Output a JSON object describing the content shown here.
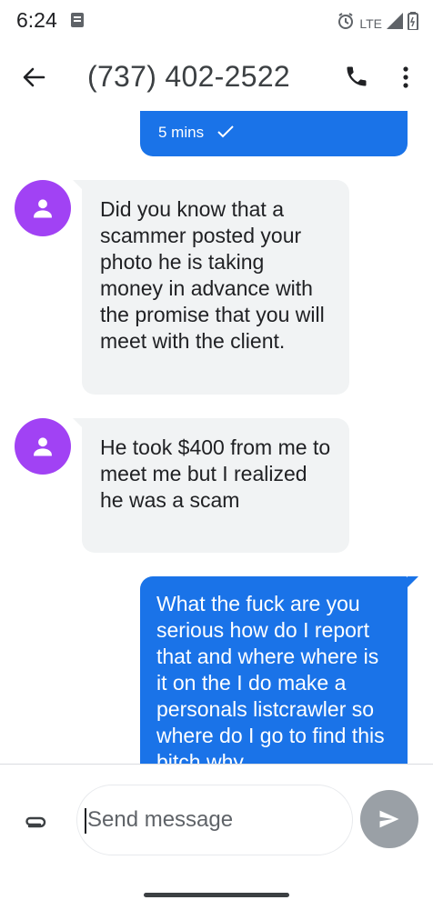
{
  "status_bar": {
    "time": "6:24",
    "network": "LTE"
  },
  "header": {
    "contact": "(737) 402-2522"
  },
  "conversation": {
    "sent_status": "5 mins",
    "messages": [
      {
        "direction": "incoming",
        "text": "Did you know that a scammer posted your photo he is taking money in advance with the promise that you will meet with the client."
      },
      {
        "direction": "incoming",
        "text": "He took $400 from me to meet me but I realized he was a scam"
      },
      {
        "direction": "outgoing",
        "text": "What the fuck are you serious how do I report that and where where is it on the I do make a personals listcrawler so where do I go to find this bitch why"
      }
    ]
  },
  "compose": {
    "placeholder": "Send message"
  },
  "colors": {
    "outgoing_bubble": "#1a73e8",
    "incoming_bubble": "#f1f3f4",
    "avatar": "#a142f4",
    "send_button": "#9aa0a6"
  }
}
